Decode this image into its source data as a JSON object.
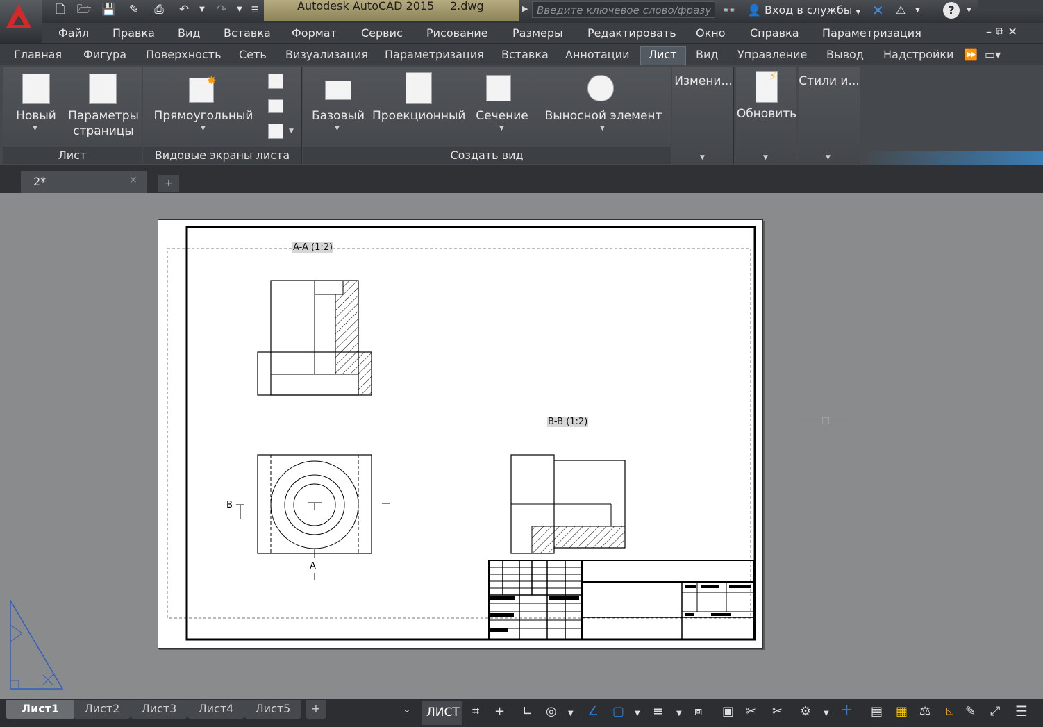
{
  "title_bar": {
    "app_name": "Autodesk AutoCAD 2015",
    "file_name": "2.dwg",
    "search_placeholder": "Введите ключевое слово/фразу",
    "signin_label": "Вход в службы"
  },
  "menu": [
    "Файл",
    "Правка",
    "Вид",
    "Вставка",
    "Формат",
    "Сервис",
    "Рисование",
    "Размеры",
    "Редактировать",
    "Окно",
    "Справка",
    "Параметризация"
  ],
  "ribbon_tabs": [
    "Главная",
    "Фигура",
    "Поверхность",
    "Сеть",
    "Визуализация",
    "Параметризация",
    "Вставка",
    "Аннотации",
    "Лист",
    "Вид",
    "Управление",
    "Вывод",
    "Надстройки"
  ],
  "active_tab": "Лист",
  "ribbon": {
    "panel_layout": {
      "label": "Лист",
      "new": "Новый",
      "page_setup_1": "Параметры",
      "page_setup_2": "страницы"
    },
    "panel_viewports": {
      "label": "Видовые экраны листа",
      "rect": "Прямоугольный"
    },
    "panel_create_view": {
      "label": "Создать вид",
      "base": "Базовый",
      "projected": "Проекционный",
      "section": "Сечение",
      "detail": "Выносной элемент"
    },
    "panel_modify": {
      "label": "Измени..."
    },
    "panel_update": {
      "label": "Обновить"
    },
    "panel_styles": {
      "label": "Стили и..."
    }
  },
  "file_tab": {
    "label": "2*"
  },
  "drawing": {
    "view_a_label": "A-A (1:2)",
    "view_b_label": "B-B (1:2)",
    "marker_b": "B",
    "marker_a": "A"
  },
  "layout_tabs": [
    "Лист1",
    "Лист2",
    "Лист3",
    "Лист4",
    "Лист5"
  ],
  "active_layout": "Лист1",
  "status": {
    "space": "ЛИСТ"
  },
  "colors": {
    "accent_blue": "#2f7fd8",
    "logo_red": "#d3292b"
  }
}
